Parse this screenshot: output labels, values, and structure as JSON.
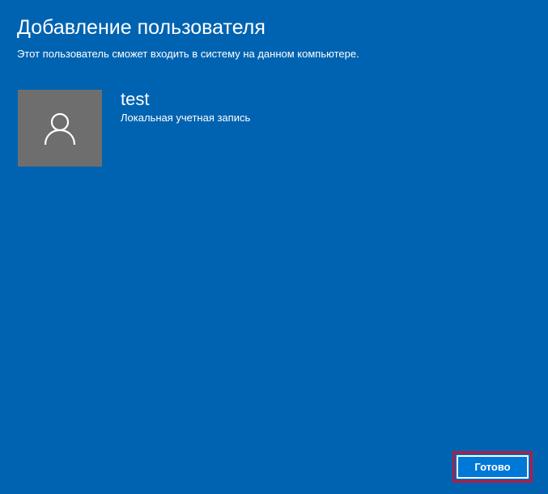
{
  "header": {
    "title": "Добавление пользователя",
    "subtitle": "Этот пользователь сможет входить в систему на данном компьютере."
  },
  "user": {
    "avatar_icon": "user-icon",
    "name": "test",
    "account_type": "Локальная учетная запись"
  },
  "footer": {
    "done_label": "Готово"
  },
  "colors": {
    "background": "#0063B1",
    "avatar_background": "#6E6E6E",
    "button_background": "#0078D7",
    "focus_outline": "#B01E45"
  }
}
